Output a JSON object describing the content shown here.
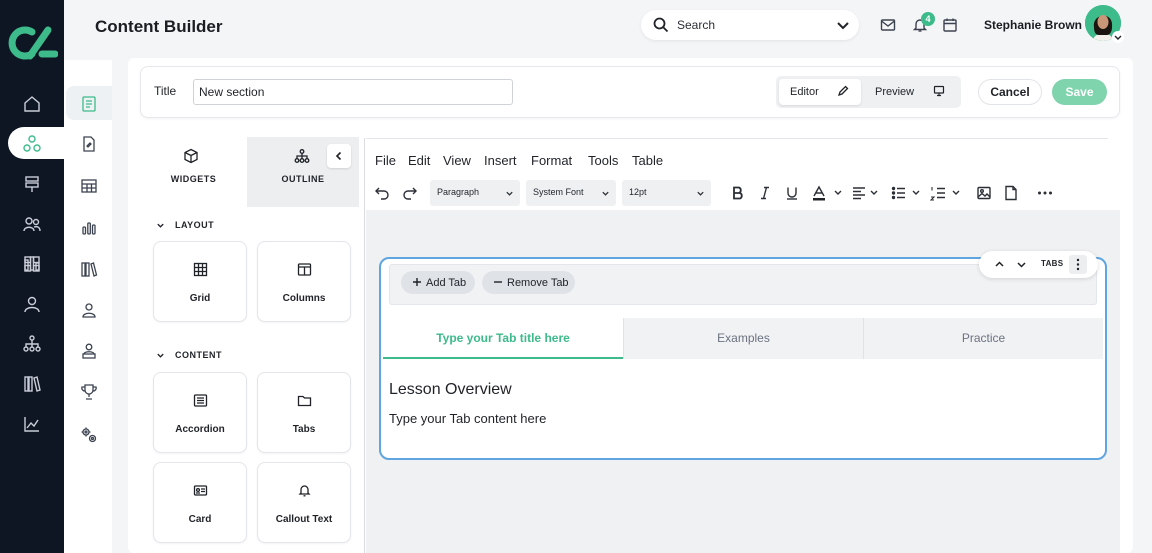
{
  "app": {
    "page_title": "Content Builder"
  },
  "header": {
    "search_placeholder": "Search",
    "notifications_count": "4",
    "user_name": "Stephanie Brown"
  },
  "form": {
    "title_label": "Title",
    "title_value": "New section",
    "mode_editor": "Editor",
    "mode_preview": "Preview",
    "cancel_label": "Cancel",
    "save_label": "Save"
  },
  "panel": {
    "tab_widgets": "WIDGETS",
    "tab_outline": "OUTLINE",
    "sections": [
      {
        "title": "LAYOUT",
        "items": [
          "Grid",
          "Columns"
        ]
      },
      {
        "title": "CONTENT",
        "items": [
          "Accordion",
          "Tabs",
          "Card",
          "Callout Text"
        ]
      }
    ]
  },
  "editor": {
    "menu": [
      "File",
      "Edit",
      "View",
      "Insert",
      "Format",
      "Tools",
      "Table"
    ],
    "block_format": "Paragraph",
    "font_family": "System Font",
    "font_size": "12pt"
  },
  "tabs_block": {
    "add_tab": "Add Tab",
    "remove_tab": "Remove Tab",
    "block_label": "TABS",
    "tabs": [
      "Type your Tab title here",
      "Examples",
      "Practice"
    ],
    "active_tab": 0,
    "heading": "Lesson Overview",
    "body": "Type your Tab content here"
  },
  "colors": {
    "accent_green": "#3dbb8a",
    "save_green": "#7fd3ad",
    "rail_dark": "#0f1623",
    "selection_blue": "#5fa5e0"
  },
  "icons": {
    "rail": [
      "home-icon",
      "widgets-icon",
      "signpost-icon",
      "users-icon",
      "chart-icon",
      "grid-icon",
      "user-icon",
      "hierarchy-icon",
      "books-icon",
      "trend-icon"
    ],
    "subrail": [
      "document-icon",
      "file-edit-icon",
      "table-icon",
      "bar-chart-icon",
      "library-icon",
      "person-icon",
      "person-badge-icon",
      "trophy-icon",
      "gears-icon"
    ]
  }
}
